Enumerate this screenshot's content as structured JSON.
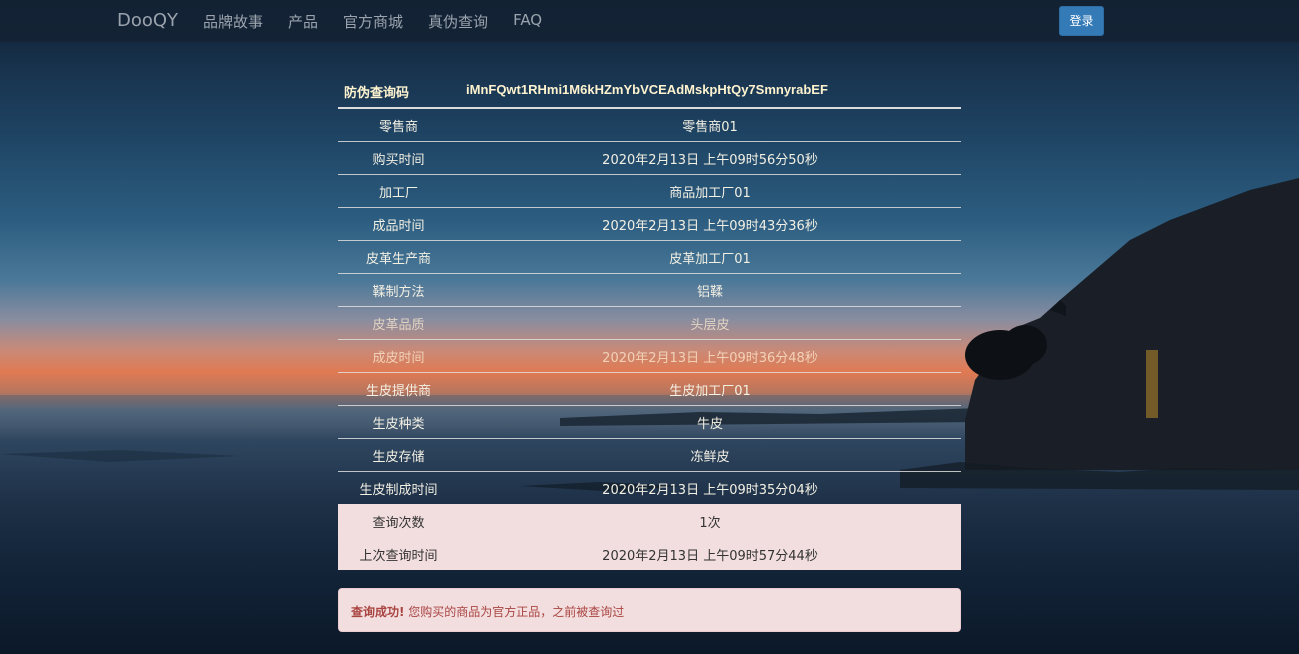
{
  "navbar": {
    "brand": "DooQY",
    "links": [
      "品牌故事",
      "产品",
      "官方商城",
      "真伪查询",
      "FAQ"
    ],
    "login_label": "登录",
    "login_color": "#337ab7"
  },
  "query": {
    "code_label": "防伪查询码",
    "code_value": "iMnFQwt1RHmi1M6kHZmYbVCEAdMskpHtQy7SmnyrabEF"
  },
  "rows": [
    {
      "key": "零售商",
      "value": "零售商01"
    },
    {
      "key": "购买时间",
      "value": "2020年2月13日 上午09时56分50秒"
    },
    {
      "key": "加工厂",
      "value": "商品加工厂01"
    },
    {
      "key": "成品时间",
      "value": "2020年2月13日 上午09时43分36秒"
    },
    {
      "key": "皮革生产商",
      "value": "皮革加工厂01"
    },
    {
      "key": "鞣制方法",
      "value": "铝鞣"
    },
    {
      "key": "皮革品质",
      "value": "头层皮"
    },
    {
      "key": "成皮时间",
      "value": "2020年2月13日 上午09时36分48秒"
    },
    {
      "key": "生皮提供商",
      "value": "生皮加工厂01"
    },
    {
      "key": "生皮种类",
      "value": "牛皮"
    },
    {
      "key": "生皮存储",
      "value": "冻鲜皮"
    },
    {
      "key": "生皮制成时间",
      "value": "2020年2月13日 上午09时35分04秒"
    },
    {
      "key": "查询次数",
      "value": "1次"
    },
    {
      "key": "上次查询时间",
      "value": "2020年2月13日 上午09时57分44秒"
    }
  ],
  "alert": {
    "strong": "查询成功!",
    "message": " 您购买的商品为官方正品，之前被查询过",
    "color": "#a94442",
    "background": "#f2dede"
  }
}
